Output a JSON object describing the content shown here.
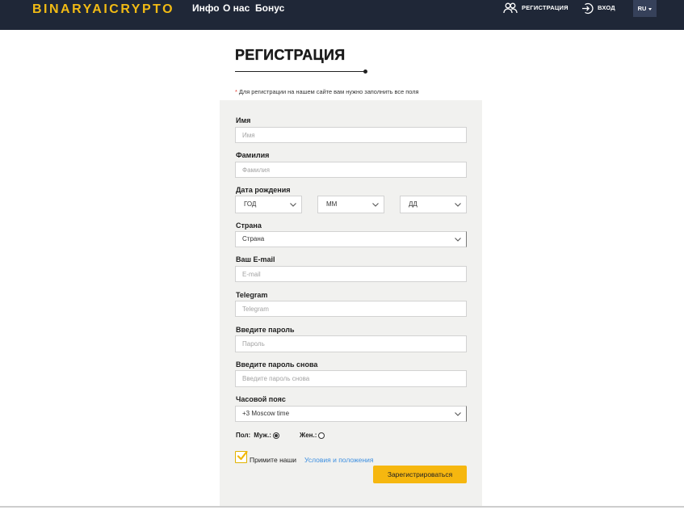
{
  "header": {
    "logo": "BINARYAICRYPTO",
    "nav": [
      {
        "label": "Инфо"
      },
      {
        "label": "О нас"
      },
      {
        "label": "Бонус"
      }
    ],
    "register_label": "РЕГИСТРАЦИЯ",
    "login_label": "ВХОД",
    "language": "RU"
  },
  "page": {
    "title": "РЕГИСТРАЦИЯ",
    "note_asterisk": "*",
    "note": "Для регистрации на нашем сайте вам нужно заполнить все поля"
  },
  "form": {
    "first_name": {
      "label": "Имя",
      "placeholder": "Имя"
    },
    "last_name": {
      "label": "Фамилия",
      "placeholder": "Фамилия"
    },
    "birth_date": {
      "label": "Дата рождения",
      "year": "ГОД",
      "month": "ММ",
      "day": "ДД"
    },
    "country": {
      "label": "Страна",
      "value": "Страна"
    },
    "email": {
      "label": "Ваш E-mail",
      "placeholder": "E-mail"
    },
    "telegram": {
      "label": "Telegram",
      "placeholder": "Telegram"
    },
    "password": {
      "label": "Введите пароль",
      "placeholder": "Пароль"
    },
    "password_repeat": {
      "label": "Введите пароль снова",
      "placeholder": "Введите пароль снова"
    },
    "timezone": {
      "label": "Часовой пояс",
      "value": "+3 Moscow time"
    },
    "gender": {
      "label": "Пол:",
      "male_label": "Муж.:",
      "female_label": "Жен.:",
      "male_checked": true,
      "female_checked": false
    },
    "terms": {
      "accepted": true,
      "text": "Примите наши",
      "link": "Условия и положения"
    },
    "submit_label": "Зарегистрироваться"
  },
  "icons": {
    "register": "users-icon",
    "login": "login-icon",
    "language_caret": "caret-down-icon",
    "select_chevron": "chevron-down-icon",
    "terms_check": "check-icon",
    "title_marker": "dot-icon"
  },
  "colors": {
    "navbar": "#1f2737",
    "logo": "#f2bb14",
    "accent": "#f6b70f",
    "link": "#3d8fe0",
    "panel": "#f1f1ef",
    "required_asterisk": "#e23a2e"
  }
}
